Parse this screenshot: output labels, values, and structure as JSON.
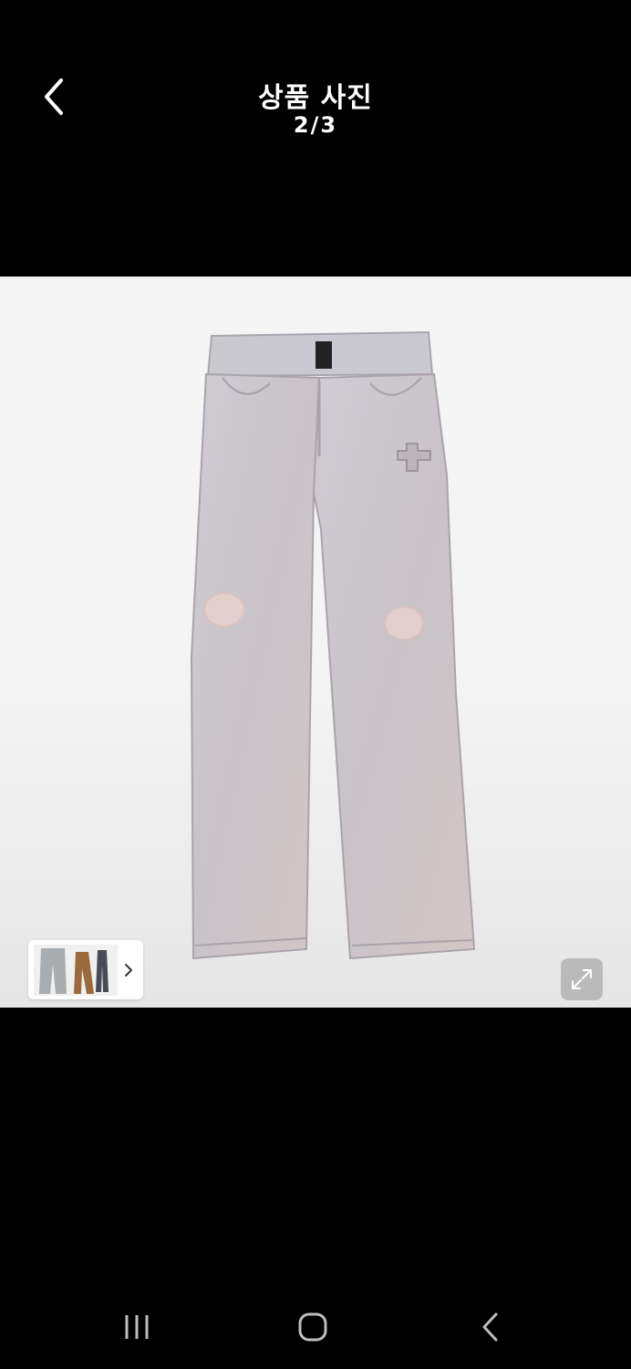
{
  "header": {
    "title": "상품 사진",
    "counter": "2/3",
    "back_icon": "chevron-left-icon"
  },
  "photo": {
    "subject": "jeans",
    "thumbnail_strip_icon": "chevron-right-icon",
    "expand_icon": "expand-icon"
  },
  "navbar": {
    "recents_icon": "recents-icon",
    "home_icon": "home-icon",
    "back_icon": "back-icon"
  },
  "colors": {
    "background": "#000000",
    "photo_bg": "#f4f4f4",
    "denim": "#c9c5cb"
  }
}
